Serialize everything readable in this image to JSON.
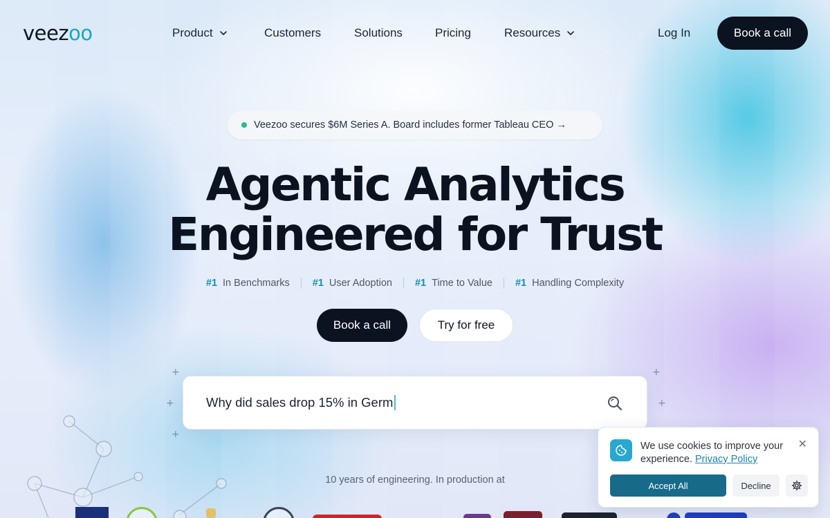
{
  "brand": {
    "logo_prefix": "veez",
    "logo_suffix": "oo"
  },
  "nav": {
    "items": [
      {
        "label": "Product",
        "has_dropdown": true
      },
      {
        "label": "Customers",
        "has_dropdown": false
      },
      {
        "label": "Solutions",
        "has_dropdown": false
      },
      {
        "label": "Pricing",
        "has_dropdown": false
      },
      {
        "label": "Resources",
        "has_dropdown": true
      }
    ],
    "login": "Log In",
    "cta": "Book a call"
  },
  "announcement": {
    "text": "Veezoo secures $6M Series A. Board includes former Tableau CEO →"
  },
  "hero": {
    "line1": "Agentic Analytics",
    "line2": "Engineered for Trust",
    "badges": [
      {
        "rank": "#1",
        "label": "In Benchmarks"
      },
      {
        "rank": "#1",
        "label": "User Adoption"
      },
      {
        "rank": "#1",
        "label": "Time to Value"
      },
      {
        "rank": "#1",
        "label": "Handling Complexity"
      }
    ],
    "primary_cta": "Book a call",
    "secondary_cta": "Try for free"
  },
  "search": {
    "typed_text": "Why did sales drop 15% in Germ"
  },
  "tagline": "10 years of engineering. In production at",
  "cookie": {
    "text": "We use cookies to improve your experience.",
    "link": "Privacy Policy",
    "accept": "Accept All",
    "decline": "Decline"
  },
  "colors": {
    "accent": "#128fb0",
    "dark": "#0b1220",
    "cookie_accept": "#176a8a",
    "status_dot": "#1fbf8f"
  }
}
